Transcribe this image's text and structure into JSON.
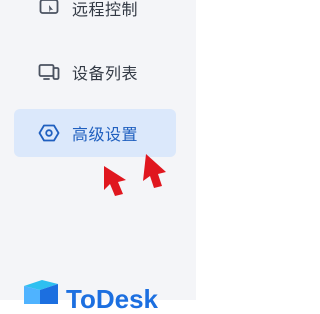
{
  "sidebar": {
    "items": [
      {
        "label": "远程控制",
        "icon": "remote-control-icon",
        "active": false
      },
      {
        "label": "设备列表",
        "icon": "device-list-icon",
        "active": false
      },
      {
        "label": "高级设置",
        "icon": "settings-icon",
        "active": true
      }
    ]
  },
  "brand": {
    "name": "ToDesk"
  },
  "colors": {
    "accent": "#1f5fbf",
    "active_bg": "#dbe8fb",
    "sidebar_bg": "#f4f5f8",
    "arrow": "#e0171f"
  }
}
